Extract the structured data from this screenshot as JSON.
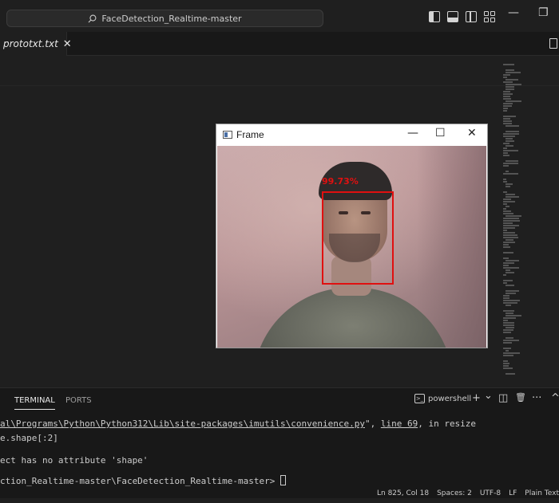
{
  "titlebar": {
    "search_text": "FaceDetection_Realtime-master",
    "minimize_glyph": "—",
    "restore_glyph": "❐"
  },
  "tabs": [
    {
      "label": "prototxt.txt",
      "close_glyph": "✕"
    }
  ],
  "frame_window": {
    "title": "Frame",
    "minimize_glyph": "—",
    "maximize_glyph": "☐",
    "close_glyph": "✕",
    "confidence": "99.73%",
    "box_color": "#e01010"
  },
  "panel": {
    "tabs": [
      {
        "label": "TERMINAL",
        "active": true
      },
      {
        "label": "PORTS",
        "active": false
      }
    ],
    "terminal_name": "powershell",
    "terminal_icon_glyph": ">_",
    "add_glyph": "+",
    "dropdown_glyph": "⌄",
    "split_glyph": "◫",
    "trash_glyph": "🗑",
    "more_glyph": "···",
    "maximize_glyph": "^"
  },
  "terminal": {
    "line1_path": "al\\Programs\\Python\\Python312\\Lib\\site-packages\\imutils\\convenience.py",
    "line1_mid": "\", ",
    "line1_line": "line 69",
    "line1_end": ", in resize",
    "line2": "e.shape[:2]",
    "line3": "ect has no attribute 'shape'",
    "line4": "ction_Realtime-master\\FaceDetection_Realtime-master> "
  },
  "statusbar": {
    "position": "Ln 825, Col 18",
    "spaces": "Spaces: 2",
    "encoding": "UTF-8",
    "eol": "LF",
    "language": "Plain Text"
  },
  "colors": {
    "editor_bg": "#1f1f1f",
    "panel_bg": "#181818",
    "detection_red": "#e01010"
  }
}
